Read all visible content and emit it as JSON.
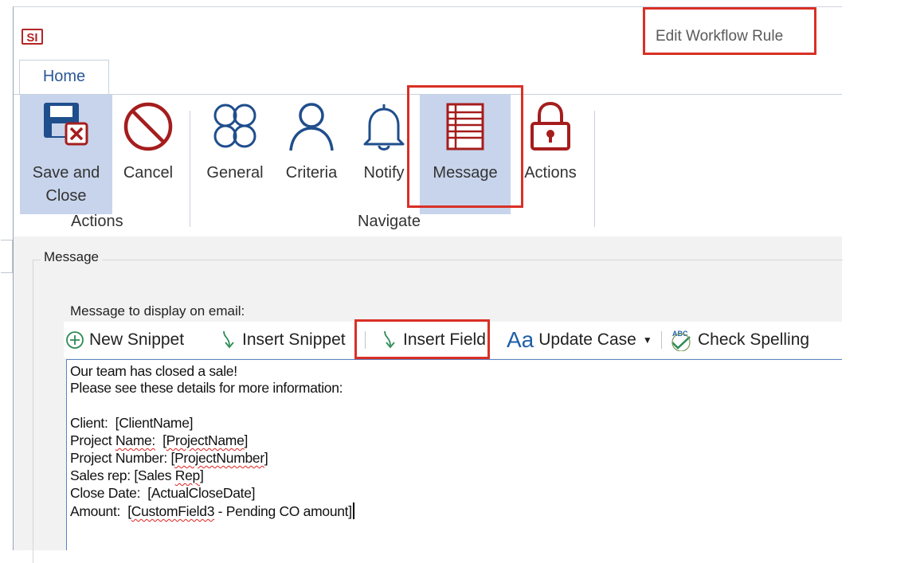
{
  "app": {
    "logo_text": "SI",
    "window_title": "Edit Workflow Rule"
  },
  "tabs": [
    {
      "label": "Home",
      "selected": true
    }
  ],
  "ribbon": {
    "groups": [
      {
        "label": "Actions",
        "buttons": [
          {
            "label_line1": "Save and",
            "label_line2": "Close",
            "icon": "save-close-icon",
            "active": true
          },
          {
            "label": "Cancel",
            "icon": "cancel-icon"
          }
        ]
      },
      {
        "label": "Navigate",
        "buttons": [
          {
            "label": "General",
            "icon": "general-icon"
          },
          {
            "label": "Criteria",
            "icon": "user-icon"
          },
          {
            "label": "Notify",
            "icon": "bell-icon"
          },
          {
            "label": "Message",
            "icon": "message-icon",
            "active": true
          },
          {
            "label": "Actions",
            "icon": "lock-icon"
          }
        ]
      }
    ]
  },
  "message_panel": {
    "group_title": "Message",
    "field_label": "Message to display on email:",
    "toolbar": {
      "new_snippet": "New Snippet",
      "insert_snippet": "Insert Snippet",
      "insert_field": "Insert Field",
      "update_case": "Update Case",
      "check_spelling": "Check Spelling"
    },
    "editor_lines": {
      "l1": "Our team has closed a sale!",
      "l2": "Please see these details for more information:",
      "client_label": "Client:  ",
      "client_field": "[ClientName]",
      "project_name_a": "Project ",
      "project_name_b": "Name:",
      "project_name_c": "  [",
      "project_name_field": "ProjectName",
      "project_name_d": "]",
      "project_number_label": "Project Number: [",
      "project_number_field": "ProjectNumber",
      "project_number_end": "]",
      "sales_rep_label": "Sales rep: [Sales ",
      "sales_rep_field": "Rep",
      "sales_rep_end": "]",
      "close_date": "Close Date:  [ActualCloseDate]",
      "amount_label": "Amount:  [",
      "amount_field": "CustomField3",
      "amount_end": " - Pending CO amount]"
    }
  },
  "colors": {
    "accent_red": "#d93025",
    "ribbon_active": "#c7d4ec",
    "icon_blue": "#1f4e8c",
    "icon_red": "#a51d1d"
  }
}
